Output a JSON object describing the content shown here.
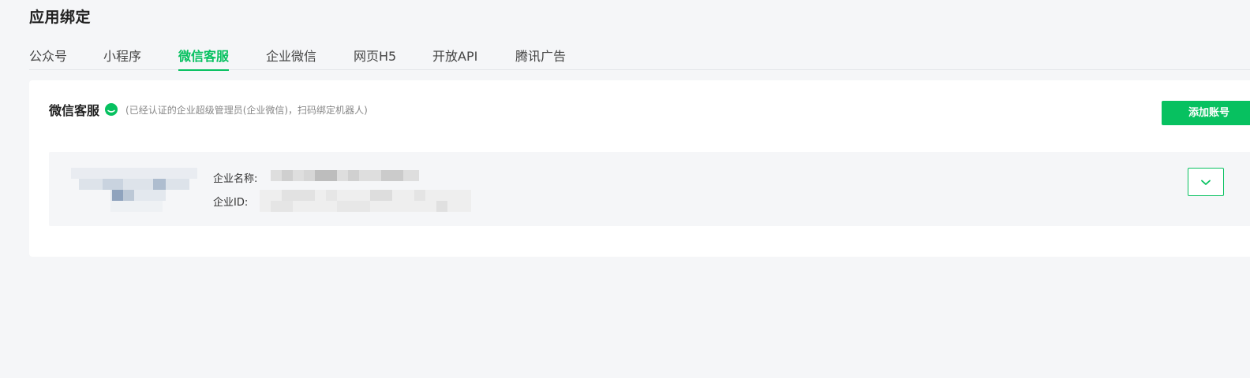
{
  "page": {
    "title": "应用绑定"
  },
  "tabs": [
    {
      "label": "公众号",
      "active": false
    },
    {
      "label": "小程序",
      "active": false
    },
    {
      "label": "微信客服",
      "active": true
    },
    {
      "label": "企业微信",
      "active": false
    },
    {
      "label": "网页H5",
      "active": false
    },
    {
      "label": "开放API",
      "active": false
    },
    {
      "label": "腾讯广告",
      "active": false
    }
  ],
  "section": {
    "title": "微信客服",
    "icon": "wechat-chat-icon",
    "hint": "(已经认证的企业超级管理员(企业微信)，扫码绑定机器人)",
    "add_button": "添加账号"
  },
  "account": {
    "name_label": "企业名称:",
    "id_label": "企业ID:",
    "avatar": "redacted-avatar",
    "expand_icon": "chevron-down-icon"
  },
  "colors": {
    "accent": "#07c160",
    "background": "#f5f6f8"
  }
}
